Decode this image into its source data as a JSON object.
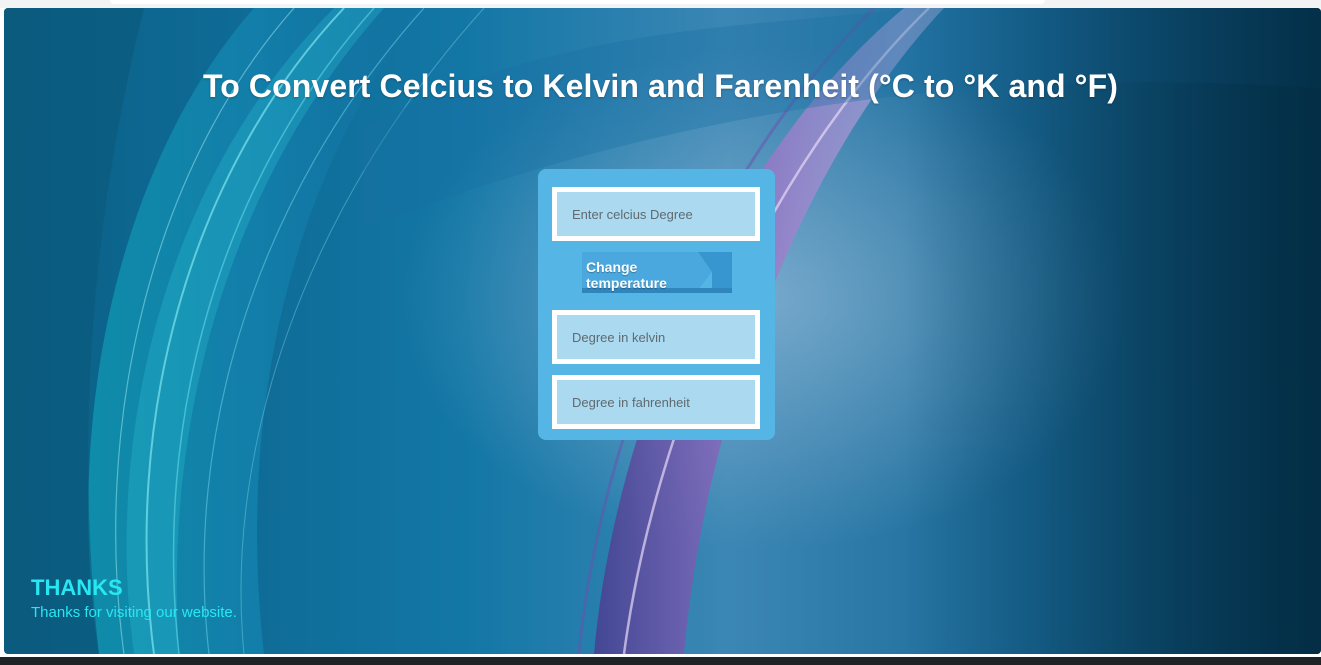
{
  "header": {
    "title": "To Convert Celcius to Kelvin and Farenheit (°C to °K and °F)"
  },
  "form": {
    "celsius_placeholder": "Enter celcius Degree",
    "convert_label": "Change temperature",
    "kelvin_placeholder": "Degree in kelvin",
    "fahrenheit_placeholder": "Degree in fahrenheit"
  },
  "footer": {
    "thanks_title": "THANKS",
    "thanks_text": "Thanks for visiting our website."
  },
  "colors": {
    "card": "#55b6e6",
    "field": "#aad9f0",
    "button": "#3fa0dc",
    "accent_text": "#27e8f2",
    "title_text": "#ffffff"
  },
  "icons": {
    "button_shape": "arrow-tag"
  }
}
